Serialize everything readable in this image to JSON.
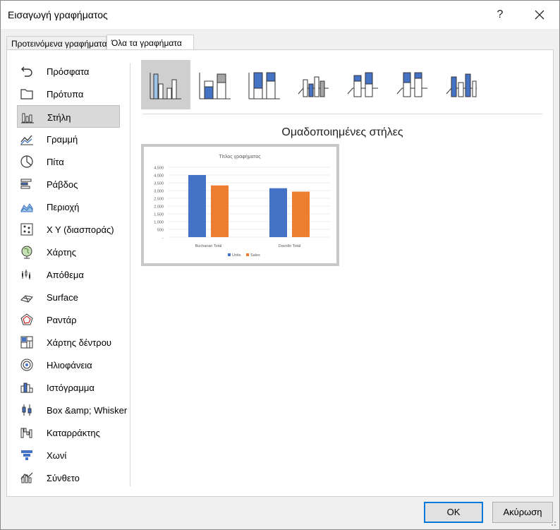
{
  "dialog": {
    "title": "Εισαγωγή γραφήματος",
    "help_label": "?",
    "close_label": "✕"
  },
  "tabs": [
    {
      "label": "Προτεινόμενα γραφήματα"
    },
    {
      "label": "Όλα τα γραφήματα"
    }
  ],
  "sidebar": {
    "selected_index": 2,
    "items": [
      {
        "label": "Πρόσφατα",
        "icon": "undo-icon"
      },
      {
        "label": "Πρότυπα",
        "icon": "folder-icon"
      },
      {
        "label": "Στήλη",
        "icon": "column-chart-icon"
      },
      {
        "label": "Γραμμή",
        "icon": "line-chart-icon"
      },
      {
        "label": "Πίτα",
        "icon": "pie-chart-icon"
      },
      {
        "label": "Ράβδος",
        "icon": "bar-chart-icon"
      },
      {
        "label": "Περιοχή",
        "icon": "area-chart-icon"
      },
      {
        "label": "X Y (διασποράς)",
        "icon": "scatter-chart-icon"
      },
      {
        "label": "Χάρτης",
        "icon": "map-chart-icon"
      },
      {
        "label": "Απόθεμα",
        "icon": "stock-chart-icon"
      },
      {
        "label": "Surface",
        "icon": "surface-chart-icon"
      },
      {
        "label": "Ραντάρ",
        "icon": "radar-chart-icon"
      },
      {
        "label": "Χάρτης δέντρου",
        "icon": "treemap-chart-icon"
      },
      {
        "label": "Ηλιοφάνεια",
        "icon": "sunburst-chart-icon"
      },
      {
        "label": "Ιστόγραμμα",
        "icon": "histogram-chart-icon"
      },
      {
        "label": "Box &amp; Whisker",
        "icon": "box-whisker-chart-icon"
      },
      {
        "label": "Καταρράκτης",
        "icon": "waterfall-chart-icon"
      },
      {
        "label": "Χωνί",
        "icon": "funnel-chart-icon"
      },
      {
        "label": "Σύνθετο",
        "icon": "combo-chart-icon"
      }
    ]
  },
  "subtypes": {
    "selected_index": 0,
    "items": [
      {
        "icon": "clustered-column-icon"
      },
      {
        "icon": "stacked-column-icon"
      },
      {
        "icon": "100-stacked-column-icon"
      },
      {
        "icon": "3d-clustered-column-icon"
      },
      {
        "icon": "3d-stacked-column-icon"
      },
      {
        "icon": "3d-100-stacked-column-icon"
      },
      {
        "icon": "3d-column-icon"
      }
    ]
  },
  "preview": {
    "heading": "Ομαδοποιημένες στήλες"
  },
  "chart_data": {
    "type": "bar",
    "title": "Τίτλος γραφήματος",
    "categories": [
      "Buchanan Total",
      "Davolio Total"
    ],
    "series": [
      {
        "name": "Units",
        "values": [
          4000,
          3150
        ],
        "color": "#4472c4"
      },
      {
        "name": "Sales",
        "values": [
          3330,
          2930
        ],
        "color": "#ed7d31"
      }
    ],
    "ylim": [
      0,
      4500
    ],
    "yticks": [
      "-",
      "500",
      "1,000",
      "1,500",
      "2,000",
      "2,500",
      "3,000",
      "3,500",
      "4,000",
      "4,500"
    ],
    "grid": true,
    "legend": "bottom"
  },
  "footer": {
    "ok_label": "OK",
    "cancel_label": "Ακύρωση"
  },
  "colors": {
    "accent": "#0078d7",
    "selected_bg": "#d9d9d9",
    "series_blue": "#4472c4",
    "series_orange": "#ed7d31"
  }
}
